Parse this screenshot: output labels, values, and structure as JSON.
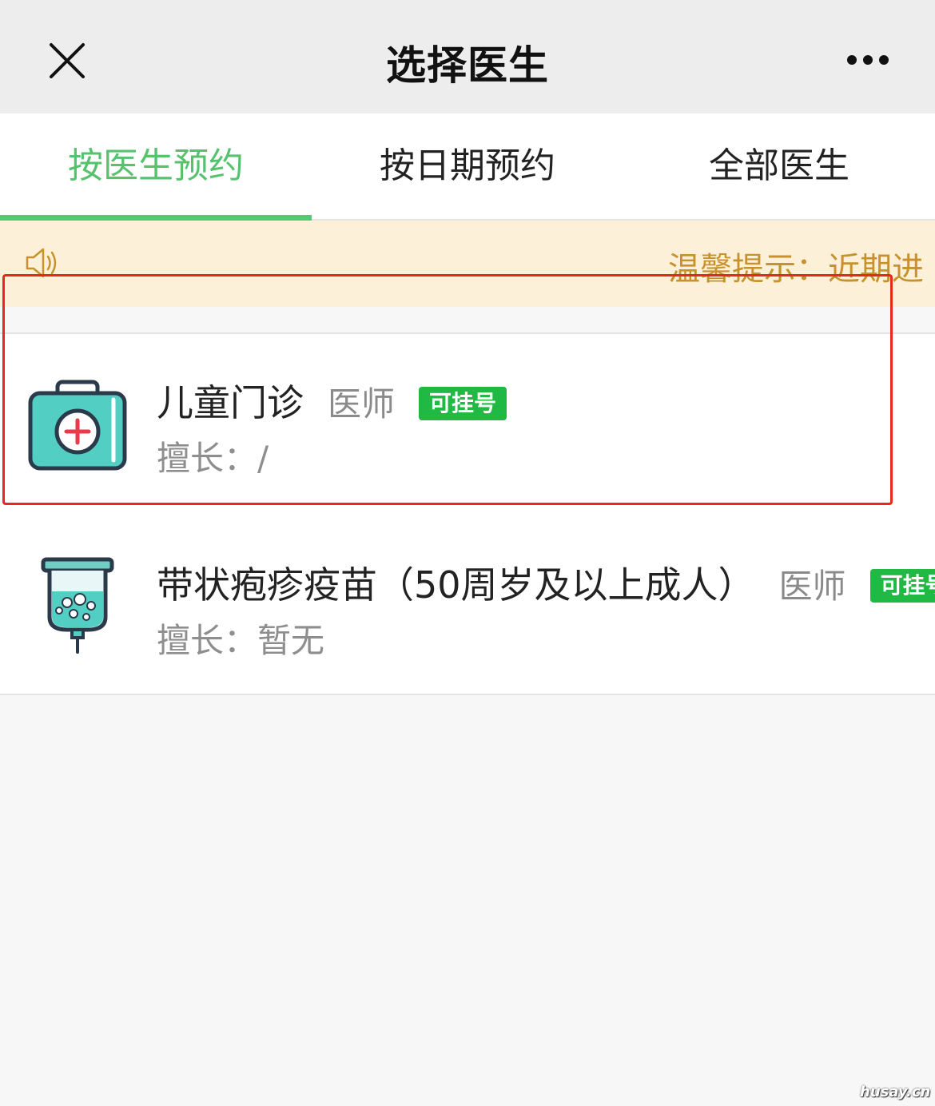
{
  "header": {
    "title": "选择医生",
    "close_icon": "close-icon",
    "more_icon": "more-dots-icon"
  },
  "tabs": [
    {
      "label": "按医生预约",
      "active": true
    },
    {
      "label": "按日期预约",
      "active": false
    },
    {
      "label": "全部医生",
      "active": false
    }
  ],
  "notice": {
    "icon": "speaker-icon",
    "text": "温馨提示：近期进"
  },
  "doctors": [
    {
      "name": "儿童门诊",
      "role": "医师",
      "status": "可挂号",
      "specialty": "擅长：/",
      "icon": "medical-kit-icon"
    },
    {
      "name": "带状疱疹疫苗（50周岁及以上成人）",
      "role": "医师",
      "status": "可挂号",
      "specialty": "擅长：暂无",
      "icon": "vaccine-bottle-icon"
    }
  ],
  "watermark": "husay.cn",
  "colors": {
    "accent": "#4fcb73",
    "badge": "#1fb944",
    "notice_bg": "#fdf0d8",
    "notice_text": "#c7922e",
    "highlight": "#e8271f"
  }
}
